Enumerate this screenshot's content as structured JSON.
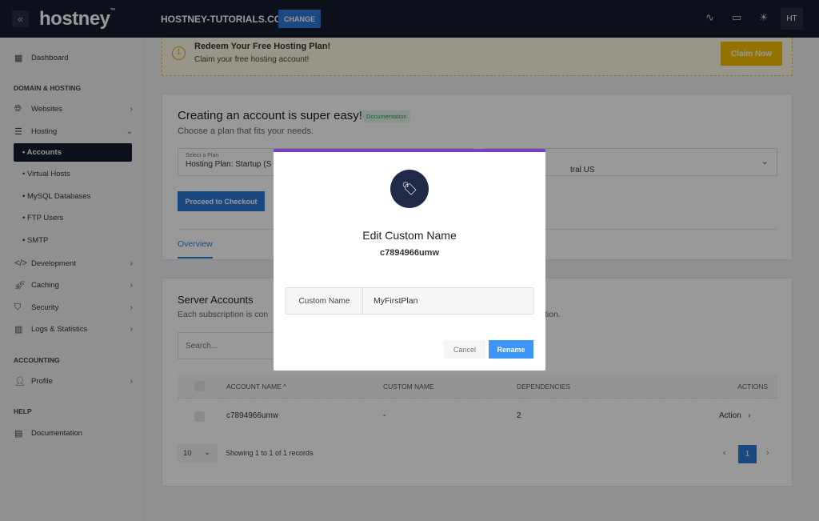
{
  "topbar": {
    "logo": "hostney",
    "logo_tm": "™",
    "domain": "HOSTNEY-TUTORIALS.COM",
    "change_label": "CHANGE",
    "avatar": "HT"
  },
  "sidebar": {
    "dashboard": "Dashboard",
    "section_domain": "DOMAIN & HOSTING",
    "websites": "Websites",
    "hosting": "Hosting",
    "hosting_sub": [
      "Accounts",
      "Virtual Hosts",
      "MySQL Databases",
      "FTP Users",
      "SMTP"
    ],
    "development": "Development",
    "caching": "Caching",
    "security": "Security",
    "logs": "Logs & Statistics",
    "section_accounting": "ACCOUNTING",
    "profile": "Profile",
    "section_help": "HELP",
    "documentation": "Documentation"
  },
  "banner": {
    "title": "Redeem Your Free Hosting Plan!",
    "subtitle": "Claim your free hosting account!",
    "icon_text": "1",
    "button": "Claim Now"
  },
  "create": {
    "title": "Creating an account is super easy!",
    "badge": "Documentation",
    "subtitle": "Choose a plan that fits your needs.",
    "plan_label": "Select a Plan",
    "plan_value": "Hosting Plan: Startup (S",
    "region_value": "tral US",
    "checkout": "Proceed to Checkout",
    "tab": "Overview"
  },
  "accounts": {
    "title": "Server Accounts",
    "subtitle_left": "Each subscription is con",
    "subtitle_right": "tion.",
    "search_placeholder": "Search...",
    "columns": [
      "ACCOUNT NAME",
      "CUSTOM NAME",
      "DEPENDENCIES",
      "ACTIONS"
    ],
    "rows": [
      {
        "account": "c7894966umw",
        "custom": "-",
        "deps": "2",
        "action": "Action"
      }
    ],
    "page_size": "10",
    "showing": "Showing 1 to 1 of 1 records",
    "page": "1"
  },
  "modal": {
    "title": "Edit Custom Name",
    "account": "c7894966umw",
    "field_label": "Custom Name",
    "field_value": "MyFirstPlan",
    "cancel": "Cancel",
    "rename": "Rename",
    "accent": "#7b3fbf",
    "icon_bg": "#1e2a47"
  }
}
